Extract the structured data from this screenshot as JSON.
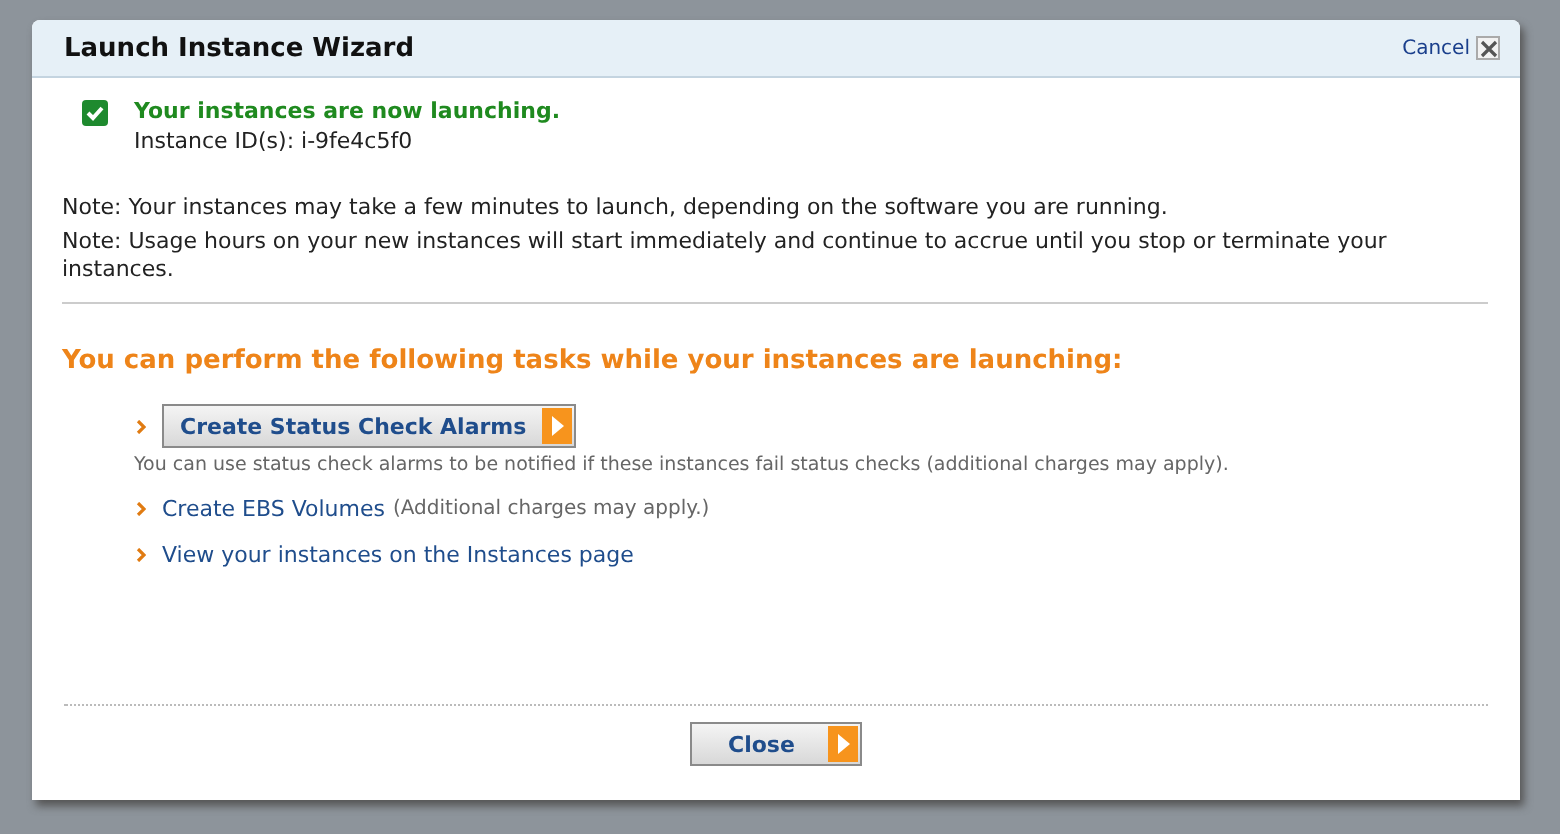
{
  "window": {
    "title": "Launch Instance Wizard",
    "cancel": "Cancel"
  },
  "status": {
    "checked": true,
    "message": "Your instances are now launching.",
    "instance_ids": "Instance ID(s): i-9fe4c5f0"
  },
  "notes": [
    "Note: Your instances may take a few minutes to launch, depending on the software you are running.",
    "Note: Usage hours on your new instances will start immediately and continue to accrue until you stop or terminate your instances."
  ],
  "tasks_heading": "You can perform the following tasks while your instances are launching:",
  "tasks": [
    {
      "kind": "button",
      "label": "Create Status Check Alarms",
      "description": "You can use status check alarms to be notified if these instances fail status checks (additional charges may apply)."
    },
    {
      "kind": "link",
      "label": "Create EBS Volumes",
      "note": "(Additional charges may apply.)"
    },
    {
      "kind": "link",
      "label": "View your instances on the Instances page"
    }
  ],
  "footer": {
    "button": "Close"
  }
}
